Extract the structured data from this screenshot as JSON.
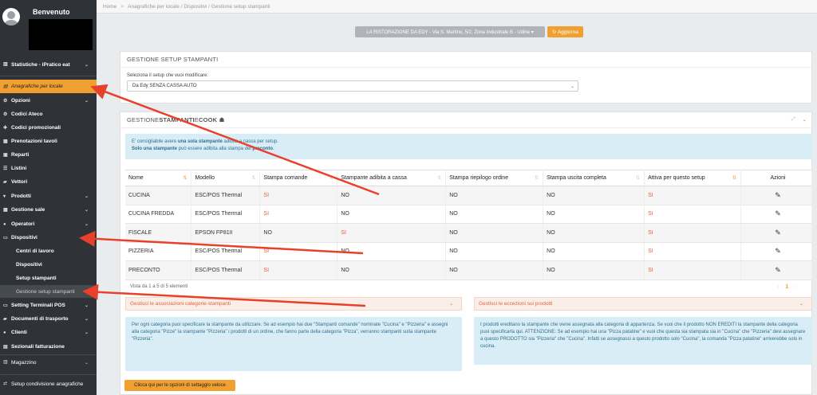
{
  "sidebar": {
    "welcome": "Benvenuto",
    "items": [
      {
        "label": "Statistiche - iPratico eat",
        "icon": "bar-chart-icon",
        "chev": true
      },
      {
        "label": "Anagrafiche per locale",
        "icon": "list-icon",
        "chev": false
      },
      {
        "label": "Opzioni",
        "icon": "cogs-icon",
        "chev": true
      },
      {
        "label": "Codici Ateco",
        "icon": "gear-icon",
        "chev": false
      },
      {
        "label": "Codici promozionali",
        "icon": "gift-icon",
        "chev": false
      },
      {
        "label": "Prenotazioni tavoli",
        "icon": "calendar-icon",
        "chev": false
      },
      {
        "label": "Reparti",
        "icon": "building-icon",
        "chev": false
      },
      {
        "label": "Listini",
        "icon": "list-icon",
        "chev": false
      },
      {
        "label": "Vettori",
        "icon": "truck-icon",
        "chev": false
      },
      {
        "label": "Prodotti",
        "icon": "cart-icon",
        "chev": true
      },
      {
        "label": "Gestione sale",
        "icon": "grid-icon",
        "chev": true
      },
      {
        "label": "Operatori",
        "icon": "user-icon",
        "chev": true
      },
      {
        "label": "Dispositivi",
        "icon": "printer-icon",
        "chev": true
      },
      {
        "label": "Centri di lavoro",
        "sub": true
      },
      {
        "label": "Dispositivi",
        "sub": true
      },
      {
        "label": "Setup stampanti",
        "sub": true
      },
      {
        "label": "Gestione setup stampanti",
        "sub": true
      },
      {
        "label": "Setting Terminali POS",
        "icon": "monitor-icon",
        "chev": true
      },
      {
        "label": "Documenti di trasporto",
        "icon": "truck-icon",
        "chev": true
      },
      {
        "label": "Clienti",
        "icon": "users-icon",
        "chev": true
      },
      {
        "label": "Sezionali fatturazione",
        "icon": "file-icon",
        "chev": false
      },
      {
        "label": "Magazzino",
        "icon": "box-icon",
        "chev": true
      },
      {
        "label": "Setup condivisione anagrafiche",
        "icon": "share-icon",
        "chev": false
      }
    ]
  },
  "breadcrumb": {
    "home": "Home",
    "sep": ">",
    "path": "Anagrafiche per locale / Dispositivi / Gestione setup stampanti"
  },
  "location": {
    "label": "LA RISTORAZIONE DA EDY - Via S. Martino, 5/2, Zona Industriale B - Udine ▾"
  },
  "refresh": {
    "label": "↻ Aggiorna"
  },
  "setup_panel": {
    "title": "GESTIONE SETUP STAMPANTI",
    "select_label": "Seleziona il setup che vuoi modificare:",
    "select_value": "Da Edy SENZA CASSA AUTO"
  },
  "printers_panel": {
    "title_a": "GESTIONE ",
    "title_b": "STAMPANTI",
    "title_c": " E ",
    "title_d": "COOK",
    "info_line1_a": "E' consigliabile avere ",
    "info_line1_b": "una sola stampante",
    "info_line1_c": " adibita a cassa per setup.",
    "info_line2_a": "Solo una stampante",
    "info_line2_b": " può essere adibita alla stampa del ",
    "info_line2_c": "preconto",
    "info_line2_d": "."
  },
  "table": {
    "headers": [
      "Nome",
      "Modello",
      "Stampa comande",
      "Stampante adibita a cassa",
      "Stampa riepilogo ordine",
      "Stampa uscita completa",
      "Attiva per questo setup",
      "Azioni"
    ],
    "rows": [
      [
        "CUCINA",
        "ESC/POS Thermal",
        "SI",
        "NO",
        "NO",
        "NO",
        "SI"
      ],
      [
        "CUCINA FREDDA",
        "ESC/POS Thermal",
        "SI",
        "NO",
        "NO",
        "NO",
        "SI"
      ],
      [
        "FISCALE",
        "EPSON FP81II",
        "NO",
        "SI",
        "NO",
        "NO",
        "SI"
      ],
      [
        "PIZZERIA",
        "ESC/POS Thermal",
        "SI",
        "NO",
        "NO",
        "NO",
        "SI"
      ],
      [
        "PRECONTO",
        "ESC/POS Thermal",
        "SI",
        "NO",
        "NO",
        "NO",
        "SI"
      ]
    ],
    "info": "Vista da 1 a 5 di 5 elementi",
    "page": "1"
  },
  "accordion_left": {
    "title": "Gestisci le associazioni categorie-stampanti",
    "text": "Per ogni categoria puoi specificare la stampante da utilizzare. Se ad esempio hai due \"Stampanti comande\" nominate \"Cucina\" e \"Pizzeria\" e assegni alla categoria \"Pizze\" la stampante \"Pizzeria\" i prodotti di un ordine, che fanno parte della categoria \"Pizza\", verranno stampanti sulla stampante \"Pizzeria\"."
  },
  "accordion_right": {
    "title": "Gestisci le eccezioni sui prodotti",
    "text": "I prodotti ereditano la stampante che viene assegnata alla categoria di appartenza. Se vuoi che il prodotto NON EREDITI la stampante della categoria puoi specificarla qui. ATTENZIONE: Se ad esempio hai una \"Pizza patatine\" e vuoi che questa sia stampata sia in \"Cucina\" che \"Pizzeria\" devi assegnare a questo PRODOTTO sia \"Pizzeria\" che \"Cucina\". Infatti se assegnassi a questo prodotto solo \"Cucina\", la comanda \"Pizza patatine\" arriverebbe solo in cucina."
  },
  "fast_button": {
    "label": "Clicca qui per le opzioni di settaggio veloce"
  },
  "colors": {
    "accent": "#f0a030",
    "sidebar": "#2f3337",
    "annotation": "#e8402a",
    "si": "#e8603c"
  }
}
